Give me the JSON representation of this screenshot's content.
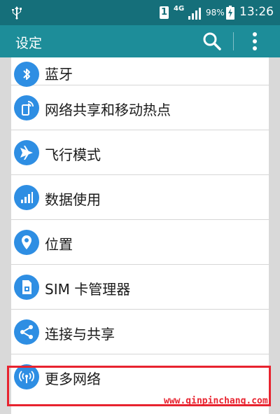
{
  "status_bar": {
    "usb_icon": "usb-icon",
    "sim_slot": "1",
    "network": "4G",
    "battery_percent": "98%",
    "time": "13:26"
  },
  "action_bar": {
    "title": "设定",
    "search_icon": "search-icon",
    "more_icon": "more-vert-icon"
  },
  "settings": {
    "items": [
      {
        "label": "蓝牙",
        "icon": "bluetooth-icon"
      },
      {
        "label": "网络共享和移动热点",
        "icon": "hotspot-icon"
      },
      {
        "label": "飞行模式",
        "icon": "airplane-icon"
      },
      {
        "label": "数据使用",
        "icon": "data-usage-icon"
      },
      {
        "label": "位置",
        "icon": "location-icon"
      },
      {
        "label": "SIM 卡管理器",
        "icon": "sim-card-icon"
      },
      {
        "label": "连接与共享",
        "icon": "share-icon"
      },
      {
        "label": "更多网络",
        "icon": "more-networks-icon"
      }
    ]
  },
  "highlight_color": "#e8232f",
  "accent_color": "#2e8ee3",
  "watermark": "www.qinpinchang.com"
}
